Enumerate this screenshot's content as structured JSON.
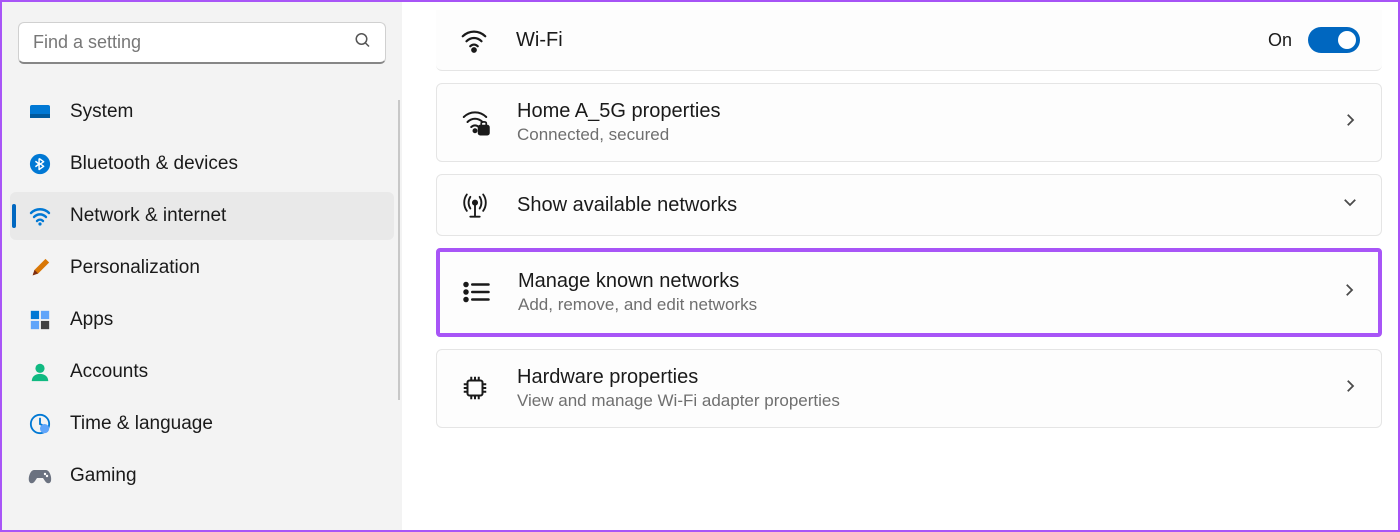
{
  "search": {
    "placeholder": "Find a setting"
  },
  "sidebar": {
    "items": [
      {
        "label": "System"
      },
      {
        "label": "Bluetooth & devices"
      },
      {
        "label": "Network & internet"
      },
      {
        "label": "Personalization"
      },
      {
        "label": "Apps"
      },
      {
        "label": "Accounts"
      },
      {
        "label": "Time & language"
      },
      {
        "label": "Gaming"
      }
    ]
  },
  "main": {
    "wifi": {
      "title": "Wi-Fi",
      "state_label": "On"
    },
    "connection": {
      "title": "Home A_5G properties",
      "subtitle": "Connected, secured"
    },
    "available": {
      "title": "Show available networks"
    },
    "manage": {
      "title": "Manage known networks",
      "subtitle": "Add, remove, and edit networks"
    },
    "hardware": {
      "title": "Hardware properties",
      "subtitle": "View and manage Wi-Fi adapter properties"
    }
  }
}
